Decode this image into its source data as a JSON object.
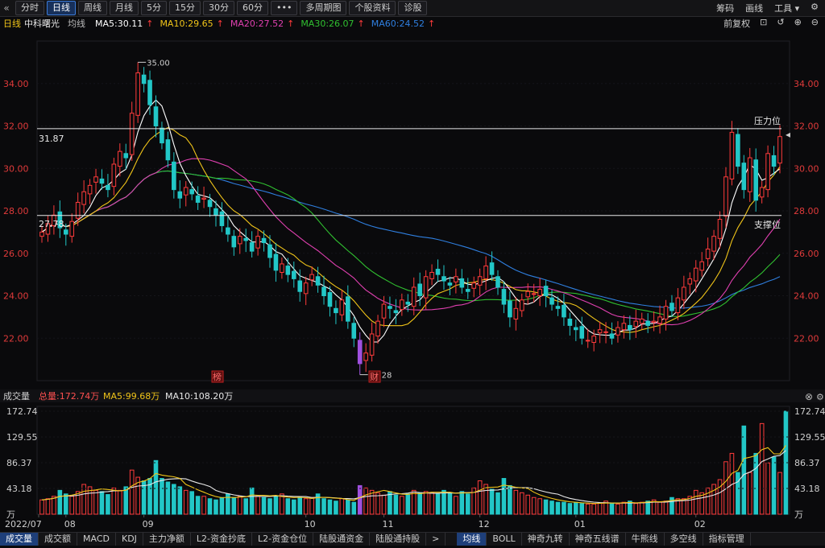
{
  "toolbar": {
    "tabs": [
      "分时",
      "日线",
      "周线",
      "月线",
      "5分",
      "15分",
      "30分",
      "60分",
      "•••",
      "多周期图",
      "个股资料",
      "诊股"
    ],
    "active_index": 1,
    "right": [
      "筹码",
      "画线",
      "工具"
    ]
  },
  "info": {
    "period": "日线",
    "stock": "中科曙光",
    "avg": "均线",
    "ma5": "MA5:30.11",
    "ma10": "MA10:29.65",
    "ma20": "MA20:27.52",
    "ma30": "MA30:26.07",
    "ma60": "MA60:24.52",
    "right_label": "前复权"
  },
  "vol_info": {
    "title": "成交量",
    "total": "总量:172.74万",
    "ma5": "MA5:99.68万",
    "ma10": "MA10:108.20万"
  },
  "bottom_tabs": [
    "成交量",
    "成交额",
    "MACD",
    "KDJ",
    "主力净额",
    "L2-资金抄底",
    "L2-资金仓位",
    "陆股通资金",
    "陆股通持股",
    ">",
    "均线",
    "BOLL",
    "神奇九转",
    "神奇五线谱",
    "牛熊线",
    "多空线",
    "指标管理"
  ],
  "colors": {
    "up": "#ff3b3b",
    "down": "#22c7c7",
    "ma5": "#ffffff",
    "ma10": "#f0c419",
    "ma20": "#e040b0",
    "ma30": "#30c030",
    "ma60": "#2f7fe0",
    "special": "#a050e0"
  },
  "chart_data": {
    "type": "candlestick",
    "stock": "中科曙光",
    "period": "日线",
    "price_ylim": [
      20.0,
      36.0
    ],
    "price_ticks": [
      "34.00",
      "32.00",
      "30.00",
      "28.00",
      "26.00",
      "24.00",
      "22.00"
    ],
    "resistance": {
      "label": "压力位",
      "value": 31.87,
      "value_text": "31.87"
    },
    "support": {
      "label": "支撑位",
      "value": 27.78,
      "value_text": "27.78"
    },
    "high_annotation": "35.00",
    "low_annotation": "20.28",
    "markers": [
      "榜",
      "财"
    ],
    "x_labels": [
      "2022/07",
      "08",
      "09",
      "10",
      "11",
      "12",
      "01",
      "02"
    ],
    "vol_ticks": [
      "172.74",
      "129.55",
      "86.37",
      "43.18",
      "万"
    ],
    "vol_ylim": [
      0,
      172.74
    ],
    "ma_last": {
      "MA5": 30.11,
      "MA10": 29.65,
      "MA20": 27.52,
      "MA30": 26.07,
      "MA60": 24.52
    },
    "closes": [
      27.0,
      27.4,
      27.8,
      27.2,
      26.9,
      27.5,
      28.4,
      28.9,
      29.2,
      29.6,
      29.3,
      29.0,
      30.2,
      30.8,
      30.5,
      32.6,
      34.5,
      34.0,
      33.0,
      32.0,
      31.2,
      30.4,
      29.0,
      28.6,
      29.1,
      28.8,
      28.4,
      28.6,
      28.2,
      27.8,
      27.3,
      26.9,
      26.3,
      26.8,
      26.6,
      26.1,
      26.8,
      26.5,
      25.8,
      25.2,
      25.5,
      25.0,
      24.8,
      24.2,
      24.6,
      25.0,
      24.5,
      24.0,
      23.5,
      23.2,
      23.8,
      22.8,
      22.0,
      20.8,
      21.3,
      22.2,
      22.8,
      23.6,
      23.4,
      23.2,
      23.8,
      23.6,
      24.4,
      24.0,
      24.9,
      25.1,
      25.0,
      24.7,
      24.5,
      24.9,
      24.4,
      24.2,
      24.6,
      24.9,
      25.4,
      25.0,
      24.4,
      23.6,
      23.0,
      23.4,
      23.8,
      24.2,
      24.1,
      24.3,
      24.0,
      23.6,
      23.4,
      23.0,
      22.6,
      22.4,
      22.0,
      21.9,
      22.1,
      22.4,
      22.3,
      22.0,
      22.5,
      22.7,
      22.4,
      22.8,
      22.9,
      22.6,
      22.8,
      23.0,
      23.5,
      23.3,
      23.9,
      24.4,
      24.8,
      25.3,
      25.6,
      26.2,
      26.8,
      27.6,
      29.6,
      31.7,
      30.1,
      29.0,
      30.5,
      28.5,
      29.1,
      30.7,
      30.1,
      31.5
    ],
    "volumes": [
      24,
      26,
      30,
      40,
      34,
      30,
      38,
      50,
      46,
      40,
      38,
      33,
      44,
      40,
      46,
      74,
      62,
      56,
      60,
      90,
      60,
      54,
      50,
      46,
      40,
      38,
      30,
      30,
      26,
      24,
      28,
      34,
      28,
      30,
      26,
      44,
      30,
      28,
      26,
      30,
      34,
      26,
      24,
      28,
      26,
      28,
      34,
      26,
      24,
      22,
      26,
      24,
      20,
      48,
      44,
      40,
      36,
      32,
      38,
      32,
      30,
      34,
      40,
      36,
      38,
      36,
      34,
      40,
      36,
      30,
      38,
      34,
      44,
      56,
      50,
      42,
      36,
      60,
      48,
      40,
      36,
      32,
      28,
      26,
      24,
      22,
      20,
      20,
      18,
      20,
      18,
      17,
      17,
      19,
      22,
      18,
      17,
      20,
      22,
      18,
      20,
      22,
      24,
      20,
      22,
      28,
      26,
      26,
      30,
      40,
      36,
      44,
      50,
      58,
      88,
      102,
      70,
      148,
      70,
      102,
      152,
      86,
      96,
      70,
      172.74
    ],
    "ma5_vol_last": 99.68,
    "ma10_vol_last": 108.2
  }
}
